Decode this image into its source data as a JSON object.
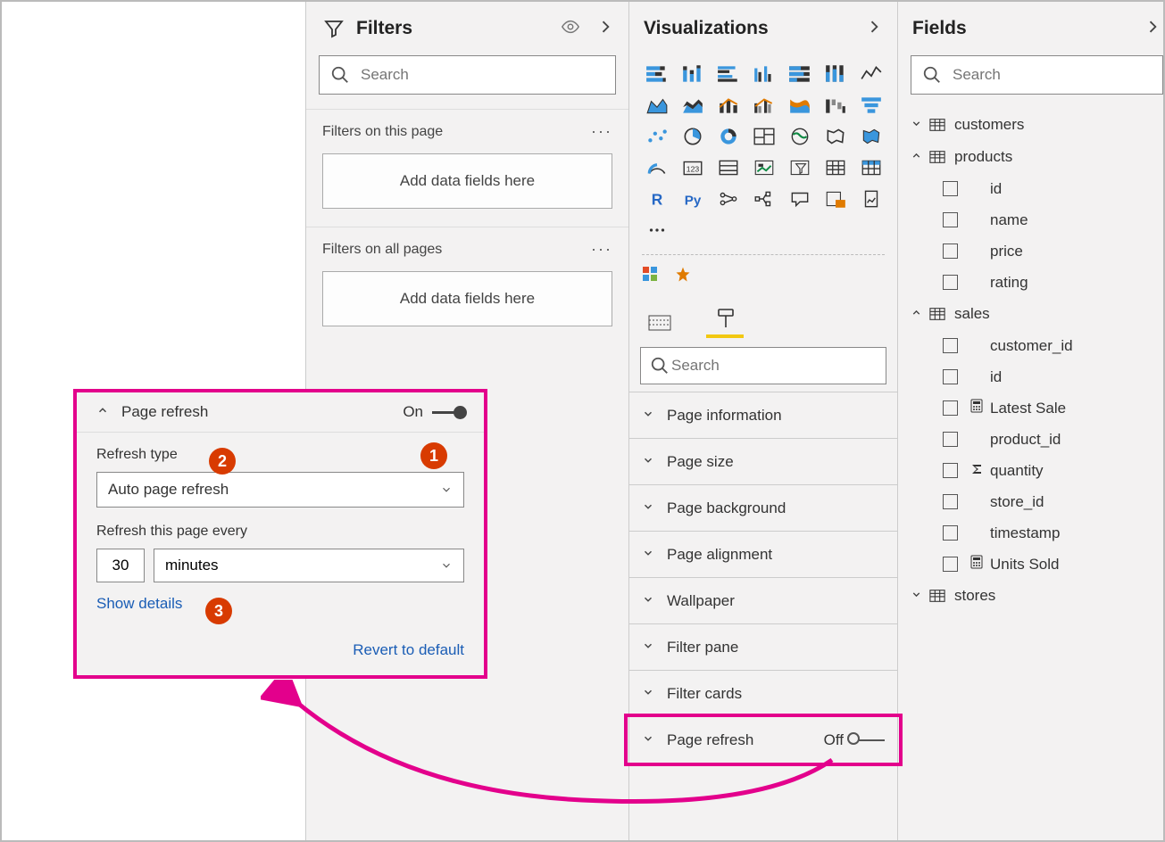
{
  "filters": {
    "title": "Filters",
    "search_placeholder": "Search",
    "on_page_label": "Filters on this page",
    "all_pages_label": "Filters on all pages",
    "drop_hint": "Add data fields here"
  },
  "visualizations": {
    "title": "Visualizations",
    "search_placeholder": "Search",
    "format_sections": [
      "Page information",
      "Page size",
      "Page background",
      "Page alignment",
      "Wallpaper",
      "Filter pane",
      "Filter cards"
    ],
    "page_refresh_label": "Page refresh",
    "page_refresh_state": "Off"
  },
  "fields": {
    "title": "Fields",
    "search_placeholder": "Search",
    "tables": [
      {
        "name": "customers",
        "expanded": false,
        "fields": []
      },
      {
        "name": "products",
        "expanded": true,
        "fields": [
          {
            "name": "id"
          },
          {
            "name": "name"
          },
          {
            "name": "price"
          },
          {
            "name": "rating"
          }
        ]
      },
      {
        "name": "sales",
        "expanded": true,
        "fields": [
          {
            "name": "customer_id"
          },
          {
            "name": "id"
          },
          {
            "name": "Latest Sale",
            "icon": "calc"
          },
          {
            "name": "product_id"
          },
          {
            "name": "quantity",
            "icon": "sigma"
          },
          {
            "name": "store_id"
          },
          {
            "name": "timestamp"
          },
          {
            "name": "Units Sold",
            "icon": "calc"
          }
        ]
      },
      {
        "name": "stores",
        "expanded": false,
        "fields": []
      }
    ]
  },
  "callout": {
    "title": "Page refresh",
    "state": "On",
    "refresh_type_label": "Refresh type",
    "refresh_type_value": "Auto page refresh",
    "interval_label": "Refresh this page every",
    "interval_value": "30",
    "interval_unit": "minutes",
    "show_details": "Show details",
    "revert": "Revert to default"
  },
  "badges": {
    "b1": "1",
    "b2": "2",
    "b3": "3"
  }
}
